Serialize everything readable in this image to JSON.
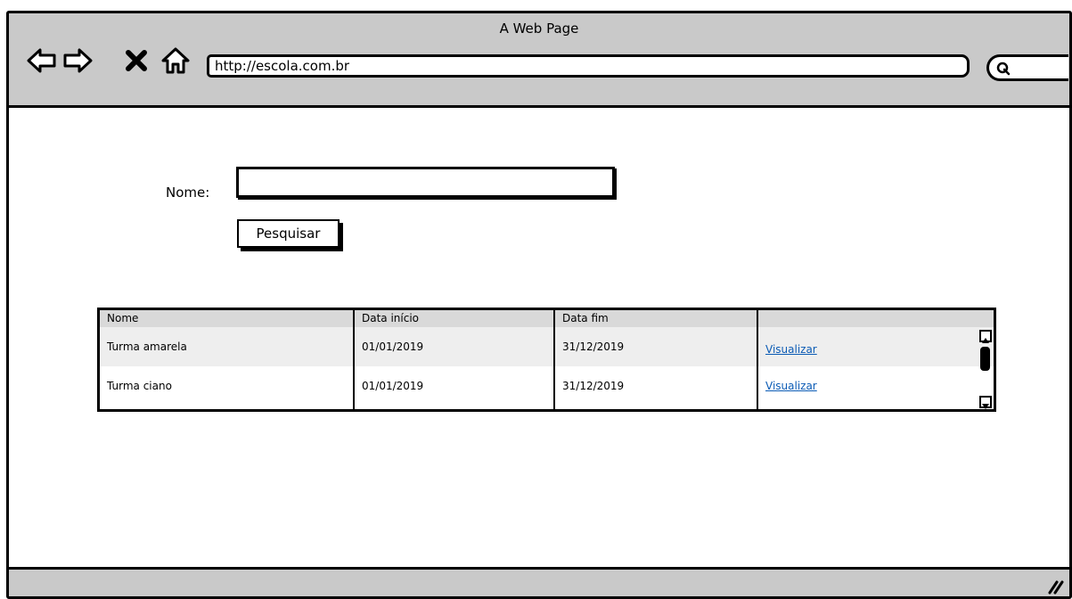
{
  "window": {
    "title": "A Web Page"
  },
  "browser": {
    "url": "http://escola.com.br",
    "nav": [
      {
        "name": "back-icon",
        "glyph": "⇦"
      },
      {
        "name": "forward-icon",
        "glyph": "⇨"
      },
      {
        "name": "close-icon",
        "glyph": "✖"
      },
      {
        "name": "home-icon",
        "glyph": "⌂"
      }
    ]
  },
  "form": {
    "name_label": "Nome:",
    "name_value": "",
    "search_button": "Pesquisar"
  },
  "table": {
    "columns": [
      "Nome",
      "Data início",
      "Data fim",
      ""
    ],
    "rows": [
      {
        "nome": "Turma amarela",
        "inicio": "01/01/2019",
        "fim": "31/12/2019",
        "action": "Visualizar"
      },
      {
        "nome": "Turma ciano",
        "inicio": "01/01/2019",
        "fim": "31/12/2019",
        "action": "Visualizar"
      }
    ]
  },
  "colors": {
    "chrome": "#c9c9c9",
    "link": "#0b5bb5",
    "header": "#d9d9d9",
    "alt_row": "#eeeeee"
  }
}
